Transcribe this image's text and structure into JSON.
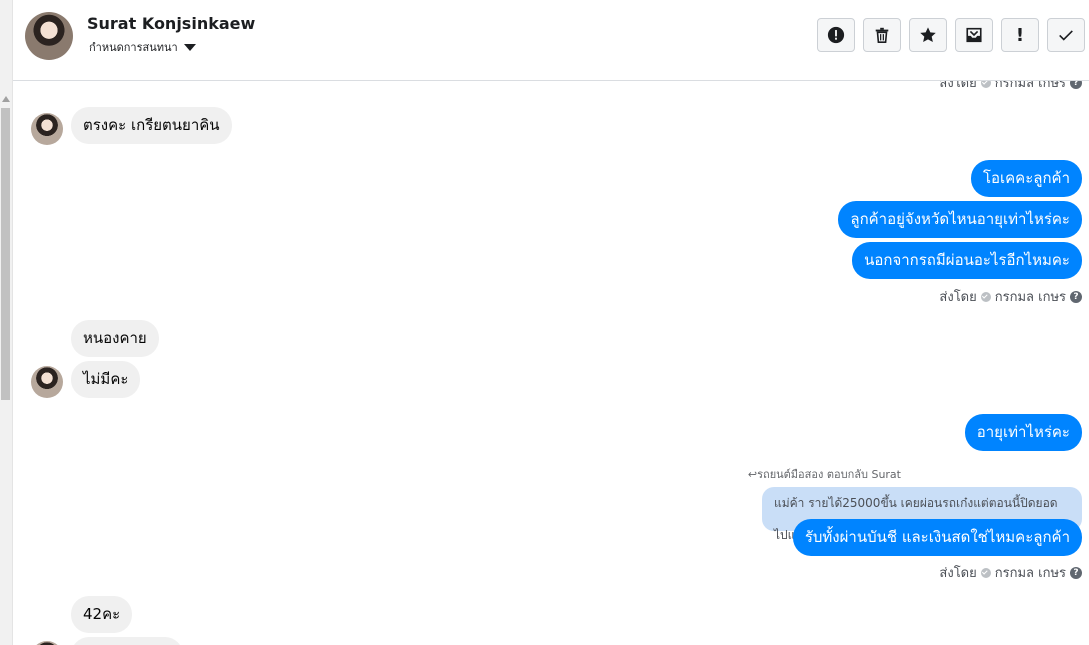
{
  "header": {
    "name": "Surat Konjsinkaew",
    "subtitle": "กำหนดการสนทนา",
    "actions": [
      {
        "icon": "exclamation-circle-icon"
      },
      {
        "icon": "trash-icon"
      },
      {
        "icon": "star-icon"
      },
      {
        "icon": "inbox-icon"
      },
      {
        "icon": "exclamation-icon",
        "label": "!"
      },
      {
        "icon": "checkmark-icon"
      }
    ]
  },
  "chat": {
    "sent_by": "ส่งโดย",
    "agent": "กรกมล เกษร",
    "messages": [
      {
        "type": "meta"
      },
      {
        "type": "in",
        "text": "ตรงคะ เกรียตนยาคิน"
      },
      {
        "type": "out",
        "text": "โอเคคะลูกค้า"
      },
      {
        "type": "out",
        "text": "ลูกค้าอยู่จังหวัดไหนอายุเท่าไหร่คะ"
      },
      {
        "type": "out",
        "text": "นอกจากรถมีผ่อนอะไรอีกไหมคะ"
      },
      {
        "type": "meta"
      },
      {
        "type": "in",
        "text": "หนองคาย"
      },
      {
        "type": "in",
        "text": "ไม่มีคะ"
      },
      {
        "type": "out",
        "text": "อายุเท่าไหร่คะ"
      },
      {
        "type": "reply",
        "label": "↩รถยนต์มือสอง ตอบกลับ Surat",
        "quote": "แม่ค้า รายได้25000ขึ้น เคยผ่อนรถเก๋งแต่ตอนนี้ปิดยอดไปแล้วคะ"
      },
      {
        "type": "out",
        "text": "รับทั้งผ่านบันชี และเงินสดใช่ไหมคะลูกค้า"
      },
      {
        "type": "meta"
      },
      {
        "type": "in",
        "text": "42คะ"
      }
    ]
  }
}
